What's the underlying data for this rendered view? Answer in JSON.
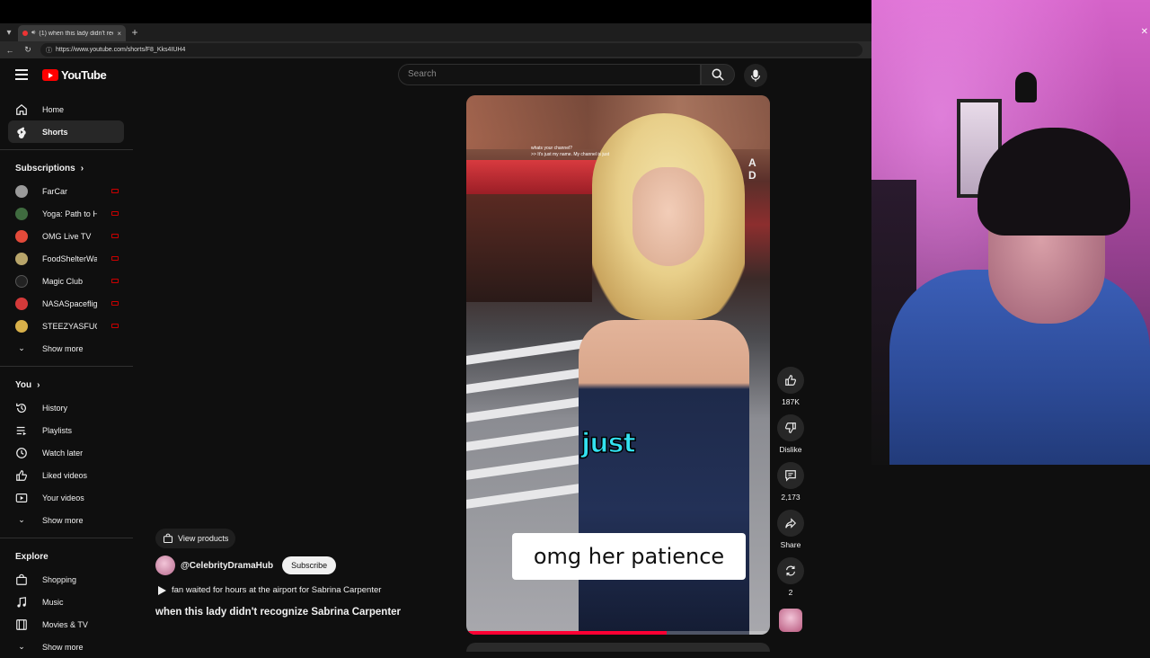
{
  "browser": {
    "tab_title": "(1) when this lady didn't reco...",
    "url": "https://www.youtube.com/shorts/F8_Kks4IUH4",
    "new_tab": "+",
    "close_tab": "×"
  },
  "masthead": {
    "logo_text": "YouTube",
    "search_placeholder": "Search"
  },
  "sidebar": {
    "main": [
      {
        "label": "Home",
        "icon": "home-icon"
      },
      {
        "label": "Shorts",
        "icon": "shorts-icon"
      }
    ],
    "subscriptions_heading": "Subscriptions",
    "subscriptions": [
      {
        "label": "FarCar",
        "color": "#9a9a9a"
      },
      {
        "label": "Yoga: Path to Ha...",
        "color": "#3f6b3f"
      },
      {
        "label": "OMG Live TV",
        "color": "#e34a3a"
      },
      {
        "label": "FoodShelterWater",
        "color": "#b8a56a"
      },
      {
        "label": "Magic Club",
        "color": "#222"
      },
      {
        "label": "NASASpaceflight",
        "color": "#d43a3a"
      },
      {
        "label": "STEEZYASFUCK",
        "color": "#d8b04a"
      }
    ],
    "subs_show_more": "Show more",
    "you_heading": "You",
    "you": [
      {
        "label": "History",
        "icon": "history-icon"
      },
      {
        "label": "Playlists",
        "icon": "playlists-icon"
      },
      {
        "label": "Watch later",
        "icon": "watch-later-icon"
      },
      {
        "label": "Liked videos",
        "icon": "liked-icon"
      },
      {
        "label": "Your videos",
        "icon": "your-videos-icon"
      }
    ],
    "you_show_more": "Show more",
    "explore_heading": "Explore",
    "explore": [
      {
        "label": "Shopping",
        "icon": "shopping-icon"
      },
      {
        "label": "Music",
        "icon": "music-icon"
      },
      {
        "label": "Movies & TV",
        "icon": "movies-icon"
      }
    ],
    "explore_show_more": "Show more"
  },
  "short": {
    "view_products": "View products",
    "channel": "@CelebrityDramaHub",
    "subscribe": "Subscribe",
    "music": "fan waited for hours at the airport for Sabrina Carpenter",
    "title": "when this lady didn't recognize Sabrina Carpenter",
    "in_video_small_caption": "whats your channel?\n>> It's just my name. My channel is just",
    "sign_text": "A D",
    "caption_word": "just",
    "caption_box": "omg her patience",
    "progress": 0.66
  },
  "actions": {
    "likes": "187K",
    "dislike": "Dislike",
    "comments": "2,173",
    "share": "Share",
    "remix": "2"
  },
  "colors": {
    "accent": "#ff0033",
    "caption_cyan": "#33e1f0",
    "background": "#0f0f0f"
  }
}
